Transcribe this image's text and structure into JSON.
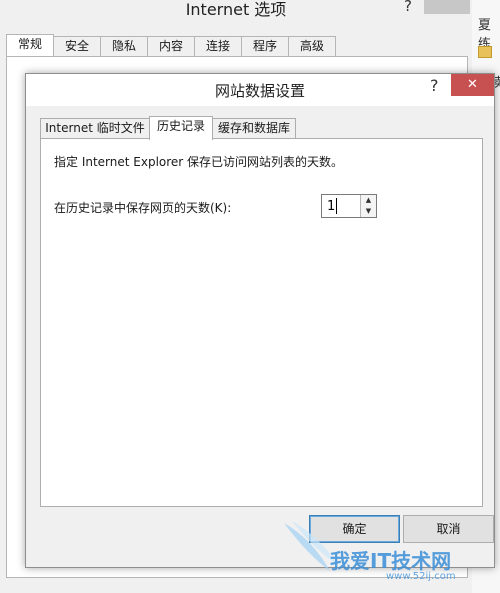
{
  "background_window": {
    "title": "Internet 选项",
    "help": "?",
    "tabs": [
      "常规",
      "安全",
      "隐私",
      "内容",
      "连接",
      "程序",
      "高级"
    ],
    "selected_tab": "常规"
  },
  "edge_window": {
    "text": "夏练",
    "text2": "卖"
  },
  "dialog": {
    "title": "网站数据设置",
    "help": "?",
    "close": "✕",
    "tabs": [
      "Internet 临时文件",
      "历史记录",
      "缓存和数据库"
    ],
    "selected_tab": "历史记录",
    "description": "指定 Internet Explorer 保存已访问网站列表的天数。",
    "days_label": "在历史记录中保存网页的天数(K):",
    "days_value": "1",
    "ok_label": "确定",
    "cancel_label": "取消"
  },
  "watermark": {
    "text": "我爱IT技术网",
    "url": "www.52ij.com"
  },
  "icons": {
    "spin_up": "▲",
    "spin_down": "▼"
  }
}
